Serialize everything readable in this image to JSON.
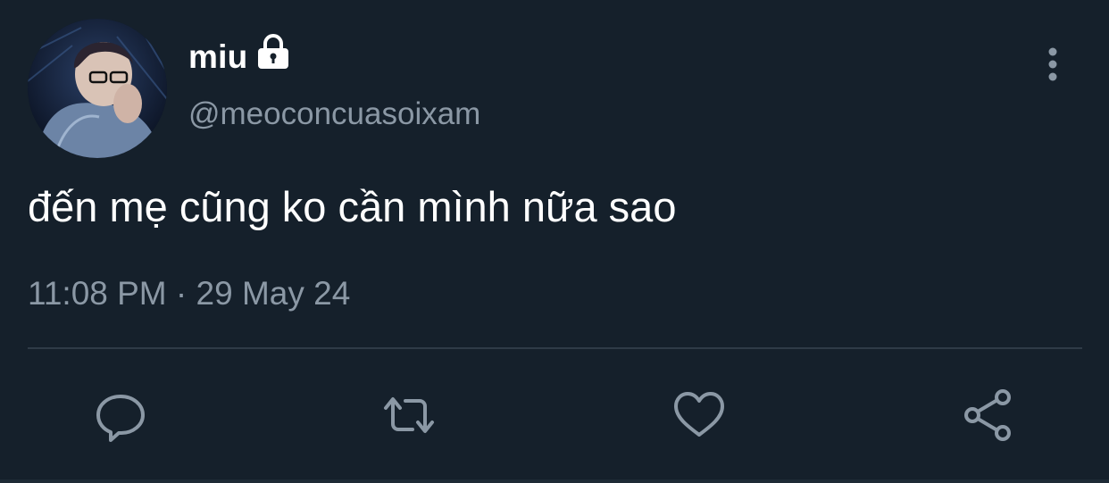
{
  "tweet": {
    "display_name": "miu",
    "handle": "@meoconcuasoixam",
    "text": "đến mẹ cũng ko cần mình nữa sao",
    "timestamp": "11:08 PM · 29 May 24",
    "protected": true
  },
  "icons": {
    "lock": "lock-icon",
    "more": "more-vertical-icon",
    "reply": "comment-icon",
    "retweet": "retweet-icon",
    "like": "heart-icon",
    "share": "share-icon"
  },
  "colors": {
    "background": "#15202b",
    "primary_text": "#ffffff",
    "secondary_text": "#8b98a5",
    "divider": "#2f3b47"
  }
}
